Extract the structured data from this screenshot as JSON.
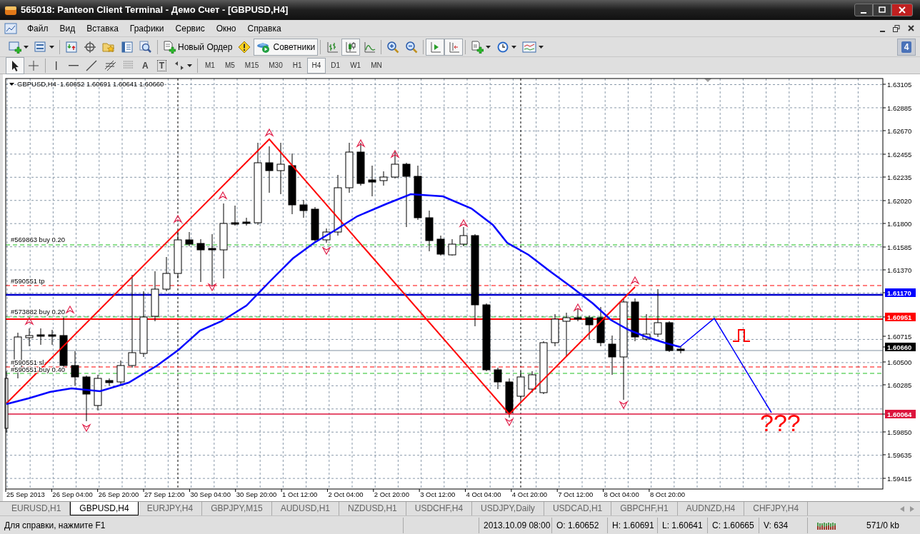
{
  "window": {
    "title": "565018: Panteon Client Terminal - Демо Счет - [GBPUSD,H4]"
  },
  "menu": [
    "Файл",
    "Вид",
    "Вставка",
    "Графики",
    "Сервис",
    "Окно",
    "Справка"
  ],
  "toolbar": {
    "new_order": {
      "label": "Новый Ордер"
    },
    "experts": {
      "label": "Советники",
      "pressed": true
    },
    "chart_types": [
      {
        "pressed": false
      },
      {
        "pressed": true
      },
      {
        "pressed": false
      }
    ],
    "scroll_buttons": [
      {
        "pressed": true
      },
      {
        "pressed": true
      }
    ],
    "notifications": {
      "count": "4"
    }
  },
  "drawing_toolbar": {
    "cursor_tools": [
      {
        "pressed": true
      },
      {
        "pressed": false
      }
    ],
    "glyph_tools": [
      "A",
      "T"
    ],
    "timeframes": [
      {
        "label": "M1",
        "selected": false
      },
      {
        "label": "M5",
        "selected": false
      },
      {
        "label": "M15",
        "selected": false
      },
      {
        "label": "M30",
        "selected": false
      },
      {
        "label": "H1",
        "selected": false
      },
      {
        "label": "H4",
        "selected": true
      },
      {
        "label": "D1",
        "selected": false
      },
      {
        "label": "W1",
        "selected": false
      },
      {
        "label": "MN",
        "selected": false
      }
    ]
  },
  "chart": {
    "symbol": "GBPUSD,H4",
    "ohlc": "1.60652 1.60691 1.60641 1.60660",
    "order_labels": [
      "#569863 buy 0.20",
      "#590551 tp",
      "#573882 buy 0.20",
      "#590551 sl",
      "#590551 buy 0.40"
    ],
    "forecast_text": "???",
    "price_axis": [
      {
        "label": "1.63105"
      },
      {
        "label": "1.62885"
      },
      {
        "label": "1.62670"
      },
      {
        "label": "1.62455"
      },
      {
        "label": "1.62235"
      },
      {
        "label": "1.62020"
      },
      {
        "label": "1.61800"
      },
      {
        "label": "1.61585"
      },
      {
        "label": "1.61370"
      },
      {
        "label": "1.61170",
        "color": "#0000ff"
      },
      {
        "label": "1.60951",
        "color": "#ff0000"
      },
      {
        "label": "1.60715"
      },
      {
        "label": "1.60660",
        "color": "#000000"
      },
      {
        "label": "1.60500"
      },
      {
        "label": "1.60285"
      },
      {
        "label": "1.60064",
        "color": "#dc143c"
      },
      {
        "label": "1.59850"
      },
      {
        "label": "1.59635"
      },
      {
        "label": "1.59415"
      }
    ],
    "time_axis": [
      "25 Sep 2013",
      "26 Sep 04:00",
      "26 Sep 20:00",
      "27 Sep 12:00",
      "30 Sep 04:00",
      "30 Sep 20:00",
      "1 Oct 12:00",
      "2 Oct 04:00",
      "2 Oct 20:00",
      "3 Oct 12:00",
      "4 Oct 04:00",
      "4 Oct 20:00",
      "7 Oct 12:00",
      "8 Oct 04:00",
      "8 Oct 20:00"
    ]
  },
  "tabs": [
    {
      "label": "EURUSD,H1",
      "selected": false
    },
    {
      "label": "GBPUSD,H4",
      "selected": true
    },
    {
      "label": "EURJPY,H4",
      "selected": false
    },
    {
      "label": "GBPJPY,M15",
      "selected": false
    },
    {
      "label": "AUDUSD,H1",
      "selected": false
    },
    {
      "label": "NZDUSD,H1",
      "selected": false
    },
    {
      "label": "USDCHF,H4",
      "selected": false
    },
    {
      "label": "USDJPY,Daily",
      "selected": false
    },
    {
      "label": "USDCAD,H1",
      "selected": false
    },
    {
      "label": "GBPCHF,H1",
      "selected": false
    },
    {
      "label": "AUDNZD,H4",
      "selected": false
    },
    {
      "label": "CHFJPY,H4",
      "selected": false
    }
  ],
  "status_bar": {
    "help": "Для справки, нажмите F1",
    "time": "2013.10.09 08:00",
    "open": "O: 1.60652",
    "high": "H: 1.60691",
    "low": "L: 1.60641",
    "close": "C: 1.60665",
    "volume": "V: 634",
    "traffic": "571/0 kb"
  }
}
